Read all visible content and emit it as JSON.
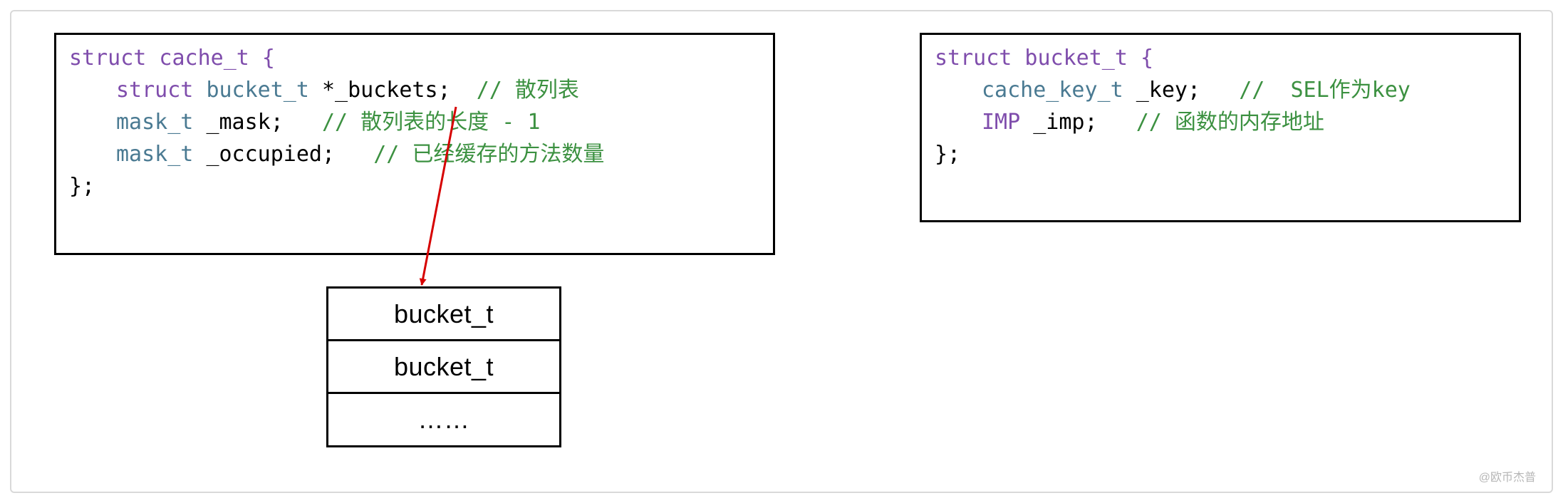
{
  "cache_t": {
    "decl_open": "struct cache_t {",
    "line1_type_kw": "struct",
    "line1_type": "bucket_t",
    "line1_var": "*_buckets;",
    "line1_comment": "// 散列表",
    "line2_type": "mask_t",
    "line2_var": "_mask;",
    "line2_comment": "// 散列表的长度 - 1",
    "line3_type": "mask_t",
    "line3_var": "_occupied;",
    "line3_comment": "// 已经缓存的方法数量",
    "decl_close": "};"
  },
  "bucket_t": {
    "decl_open": "struct bucket_t {",
    "line1_type": "cache_key_t",
    "line1_var": "_key;",
    "line1_comment": "//  SEL作为key",
    "line2_type": "IMP",
    "line2_var": "_imp;",
    "line2_comment": "// 函数的内存地址",
    "decl_close": "};"
  },
  "table": {
    "row1": "bucket_t",
    "row2": "bucket_t",
    "row3": "……"
  },
  "watermark": "@欧币杰普"
}
